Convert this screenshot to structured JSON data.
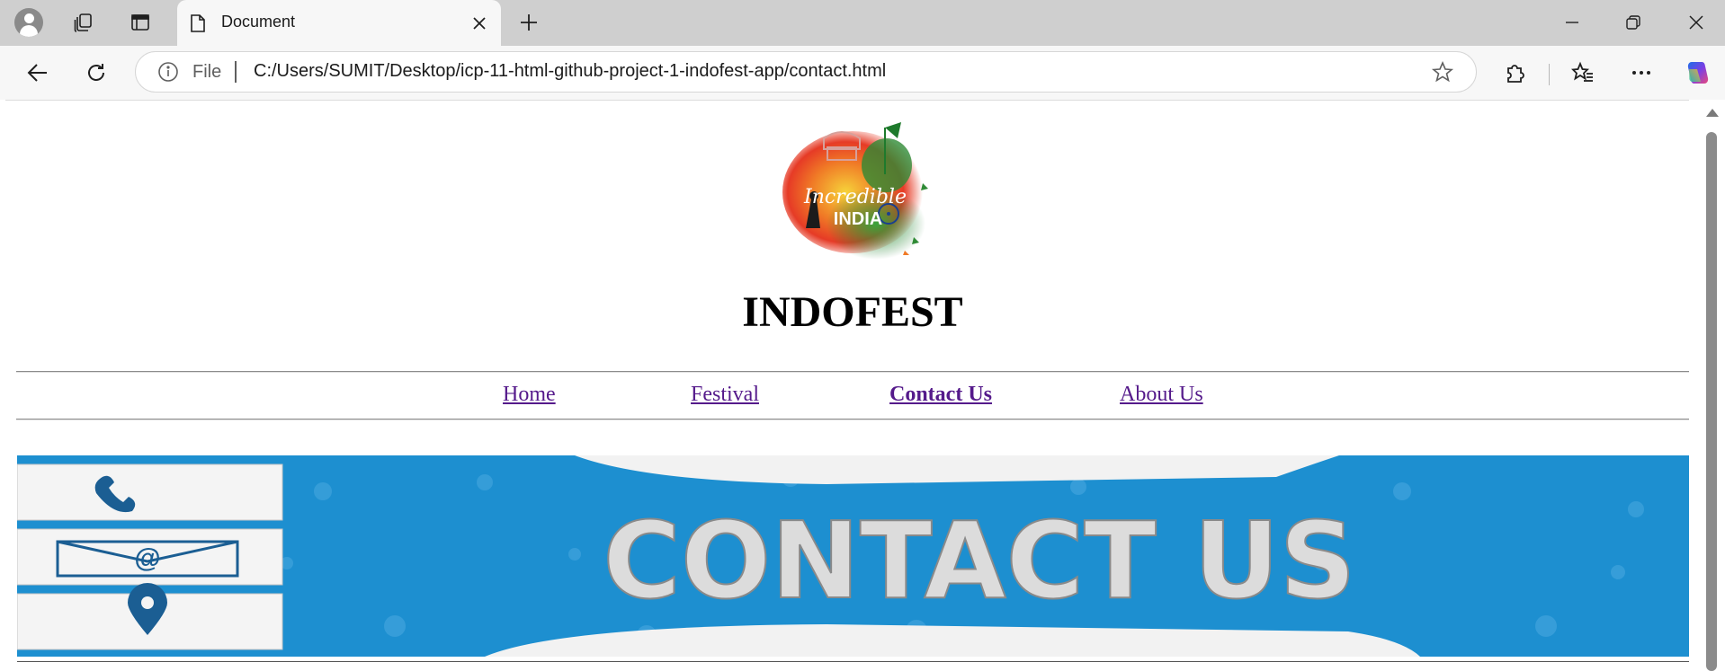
{
  "browser": {
    "tab_title": "Document",
    "address_scheme_label": "File",
    "url": "C:/Users/SUMIT/Desktop/icp-11-html-github-project-1-indofest-app/contact.html"
  },
  "page": {
    "logo_text_line1": "Incredible",
    "logo_text_line2": "INDIA",
    "site_title": "INDOFEST",
    "nav": [
      {
        "label": "Home"
      },
      {
        "label": "Festival"
      },
      {
        "label": "Contact Us"
      },
      {
        "label": "About Us"
      }
    ],
    "banner_text": "CONTACT US",
    "link_color": "#551a8b",
    "banner_color": "#1d8fd0"
  }
}
